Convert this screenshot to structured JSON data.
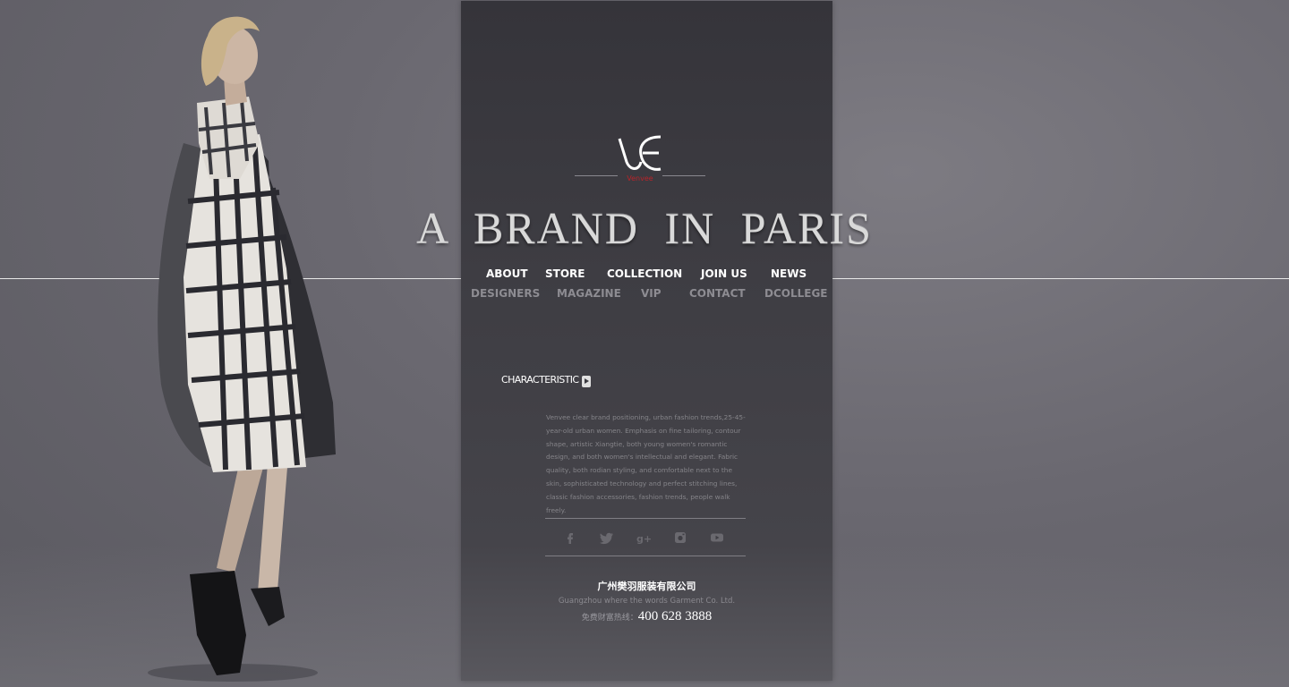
{
  "brand": {
    "logo_mark": "VE",
    "logo_word": "Venvee",
    "headline": "A BRAND IN PARIS"
  },
  "nav": {
    "main": [
      {
        "label": "ABOUT"
      },
      {
        "label": "STORE"
      },
      {
        "label": "COLLECTION"
      },
      {
        "label": "JOIN US"
      },
      {
        "label": "NEWS"
      }
    ],
    "sub": [
      {
        "label": "DESIGNERS"
      },
      {
        "label": "MAGAZINE"
      },
      {
        "label": "VIP"
      },
      {
        "label": "CONTACT"
      },
      {
        "label": "DCOLLEGE"
      }
    ]
  },
  "characteristic": {
    "title": "CHARACTERISTIC",
    "description": "Venvee clear brand positioning, urban fashion trends,25-45-year-old urban women. Emphasis on fine tailoring, contour shape, artistic Xiangtie, both young women's romantic design, and both women's intellectual and elegant. Fabric quality, both rodian styling, and comfortable next to the skin, sophisticated technology and perfect stitching lines, classic fashion accessories, fashion trends, people walk freely."
  },
  "social": [
    "facebook-icon",
    "twitter-icon",
    "google-plus-icon",
    "instagram-icon",
    "youtube-icon"
  ],
  "company": {
    "name_cn": "广州樊羽服装有限公司",
    "name_en": "Guangzhou where the words Garment Co. Ltd.",
    "hotline_label": "免费财富热线：",
    "hotline_number": "400 628 3888"
  },
  "colors": {
    "background": "#6a6870",
    "panel": "#3e3d43",
    "logo_accent": "#b8242a",
    "nav_main": "#ffffff",
    "nav_sub": "#8d8c92"
  }
}
